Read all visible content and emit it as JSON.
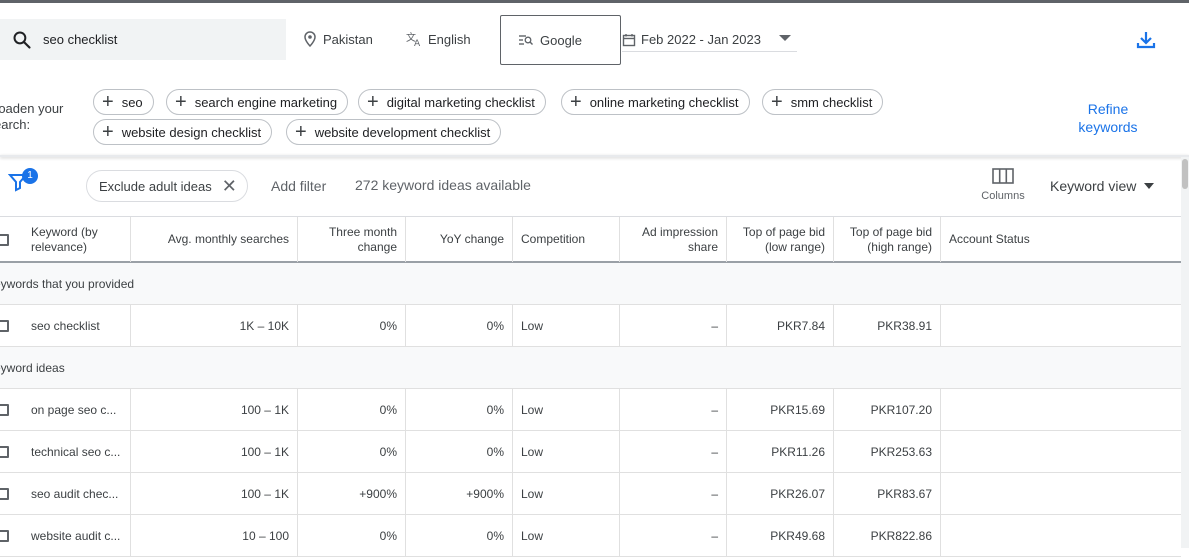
{
  "search": {
    "query": "seo checklist"
  },
  "location": {
    "label": "Pakistan"
  },
  "language": {
    "label": "English"
  },
  "network": {
    "label": "Google"
  },
  "date_range": {
    "label": "Feb 2022 - Jan 2023"
  },
  "broaden": {
    "label": "roaden your earch:",
    "label_line1": "roaden your",
    "label_line2": "earch:",
    "chips": [
      "seo",
      "search engine marketing",
      "digital marketing checklist",
      "online marketing checklist",
      "smm checklist",
      "website design checklist",
      "website development checklist"
    ],
    "refine_line1": "Refine",
    "refine_line2": "keywords"
  },
  "filters": {
    "badge_count": "1",
    "exclude_chip": "Exclude adult ideas",
    "add_filter": "Add filter",
    "ideas_available": "272 keyword ideas available",
    "columns_label": "Columns",
    "keyword_view": "Keyword view"
  },
  "table": {
    "headers": {
      "keyword_line1": "Keyword (by",
      "keyword_line2": "relevance)",
      "avg_monthly": "Avg. monthly searches",
      "three_month_line1": "Three month",
      "three_month_line2": "change",
      "yoy": "YoY change",
      "competition": "Competition",
      "ad_impr_line1": "Ad impression",
      "ad_impr_line2": "share",
      "top_low_line1": "Top of page bid",
      "top_low_line2": "(low range)",
      "top_high_line1": "Top of page bid",
      "top_high_line2": "(high range)",
      "account_status": "Account Status"
    },
    "section_provided": "eywords that you provided",
    "section_ideas": "eyword ideas",
    "provided_rows": [
      {
        "keyword": "seo checklist",
        "avg": "1K – 10K",
        "three_month": "0%",
        "yoy": "0%",
        "competition": "Low",
        "ad_share": "–",
        "bid_low": "PKR7.84",
        "bid_high": "PKR38.91"
      }
    ],
    "idea_rows": [
      {
        "keyword": "on page seo c...",
        "avg": "100 – 1K",
        "three_month": "0%",
        "yoy": "0%",
        "competition": "Low",
        "ad_share": "–",
        "bid_low": "PKR15.69",
        "bid_high": "PKR107.20"
      },
      {
        "keyword": "technical seo c...",
        "avg": "100 – 1K",
        "three_month": "0%",
        "yoy": "0%",
        "competition": "Low",
        "ad_share": "–",
        "bid_low": "PKR11.26",
        "bid_high": "PKR253.63"
      },
      {
        "keyword": "seo audit chec...",
        "avg": "100 – 1K",
        "three_month": "+900%",
        "yoy": "+900%",
        "competition": "Low",
        "ad_share": "–",
        "bid_low": "PKR26.07",
        "bid_high": "PKR83.67"
      },
      {
        "keyword": "website audit c...",
        "avg": "10 – 100",
        "three_month": "0%",
        "yoy": "0%",
        "competition": "Low",
        "ad_share": "–",
        "bid_low": "PKR49.68",
        "bid_high": "PKR822.86"
      }
    ]
  },
  "colors": {
    "accent": "#1a73e8",
    "text": "#202124",
    "muted": "#5f6368"
  }
}
